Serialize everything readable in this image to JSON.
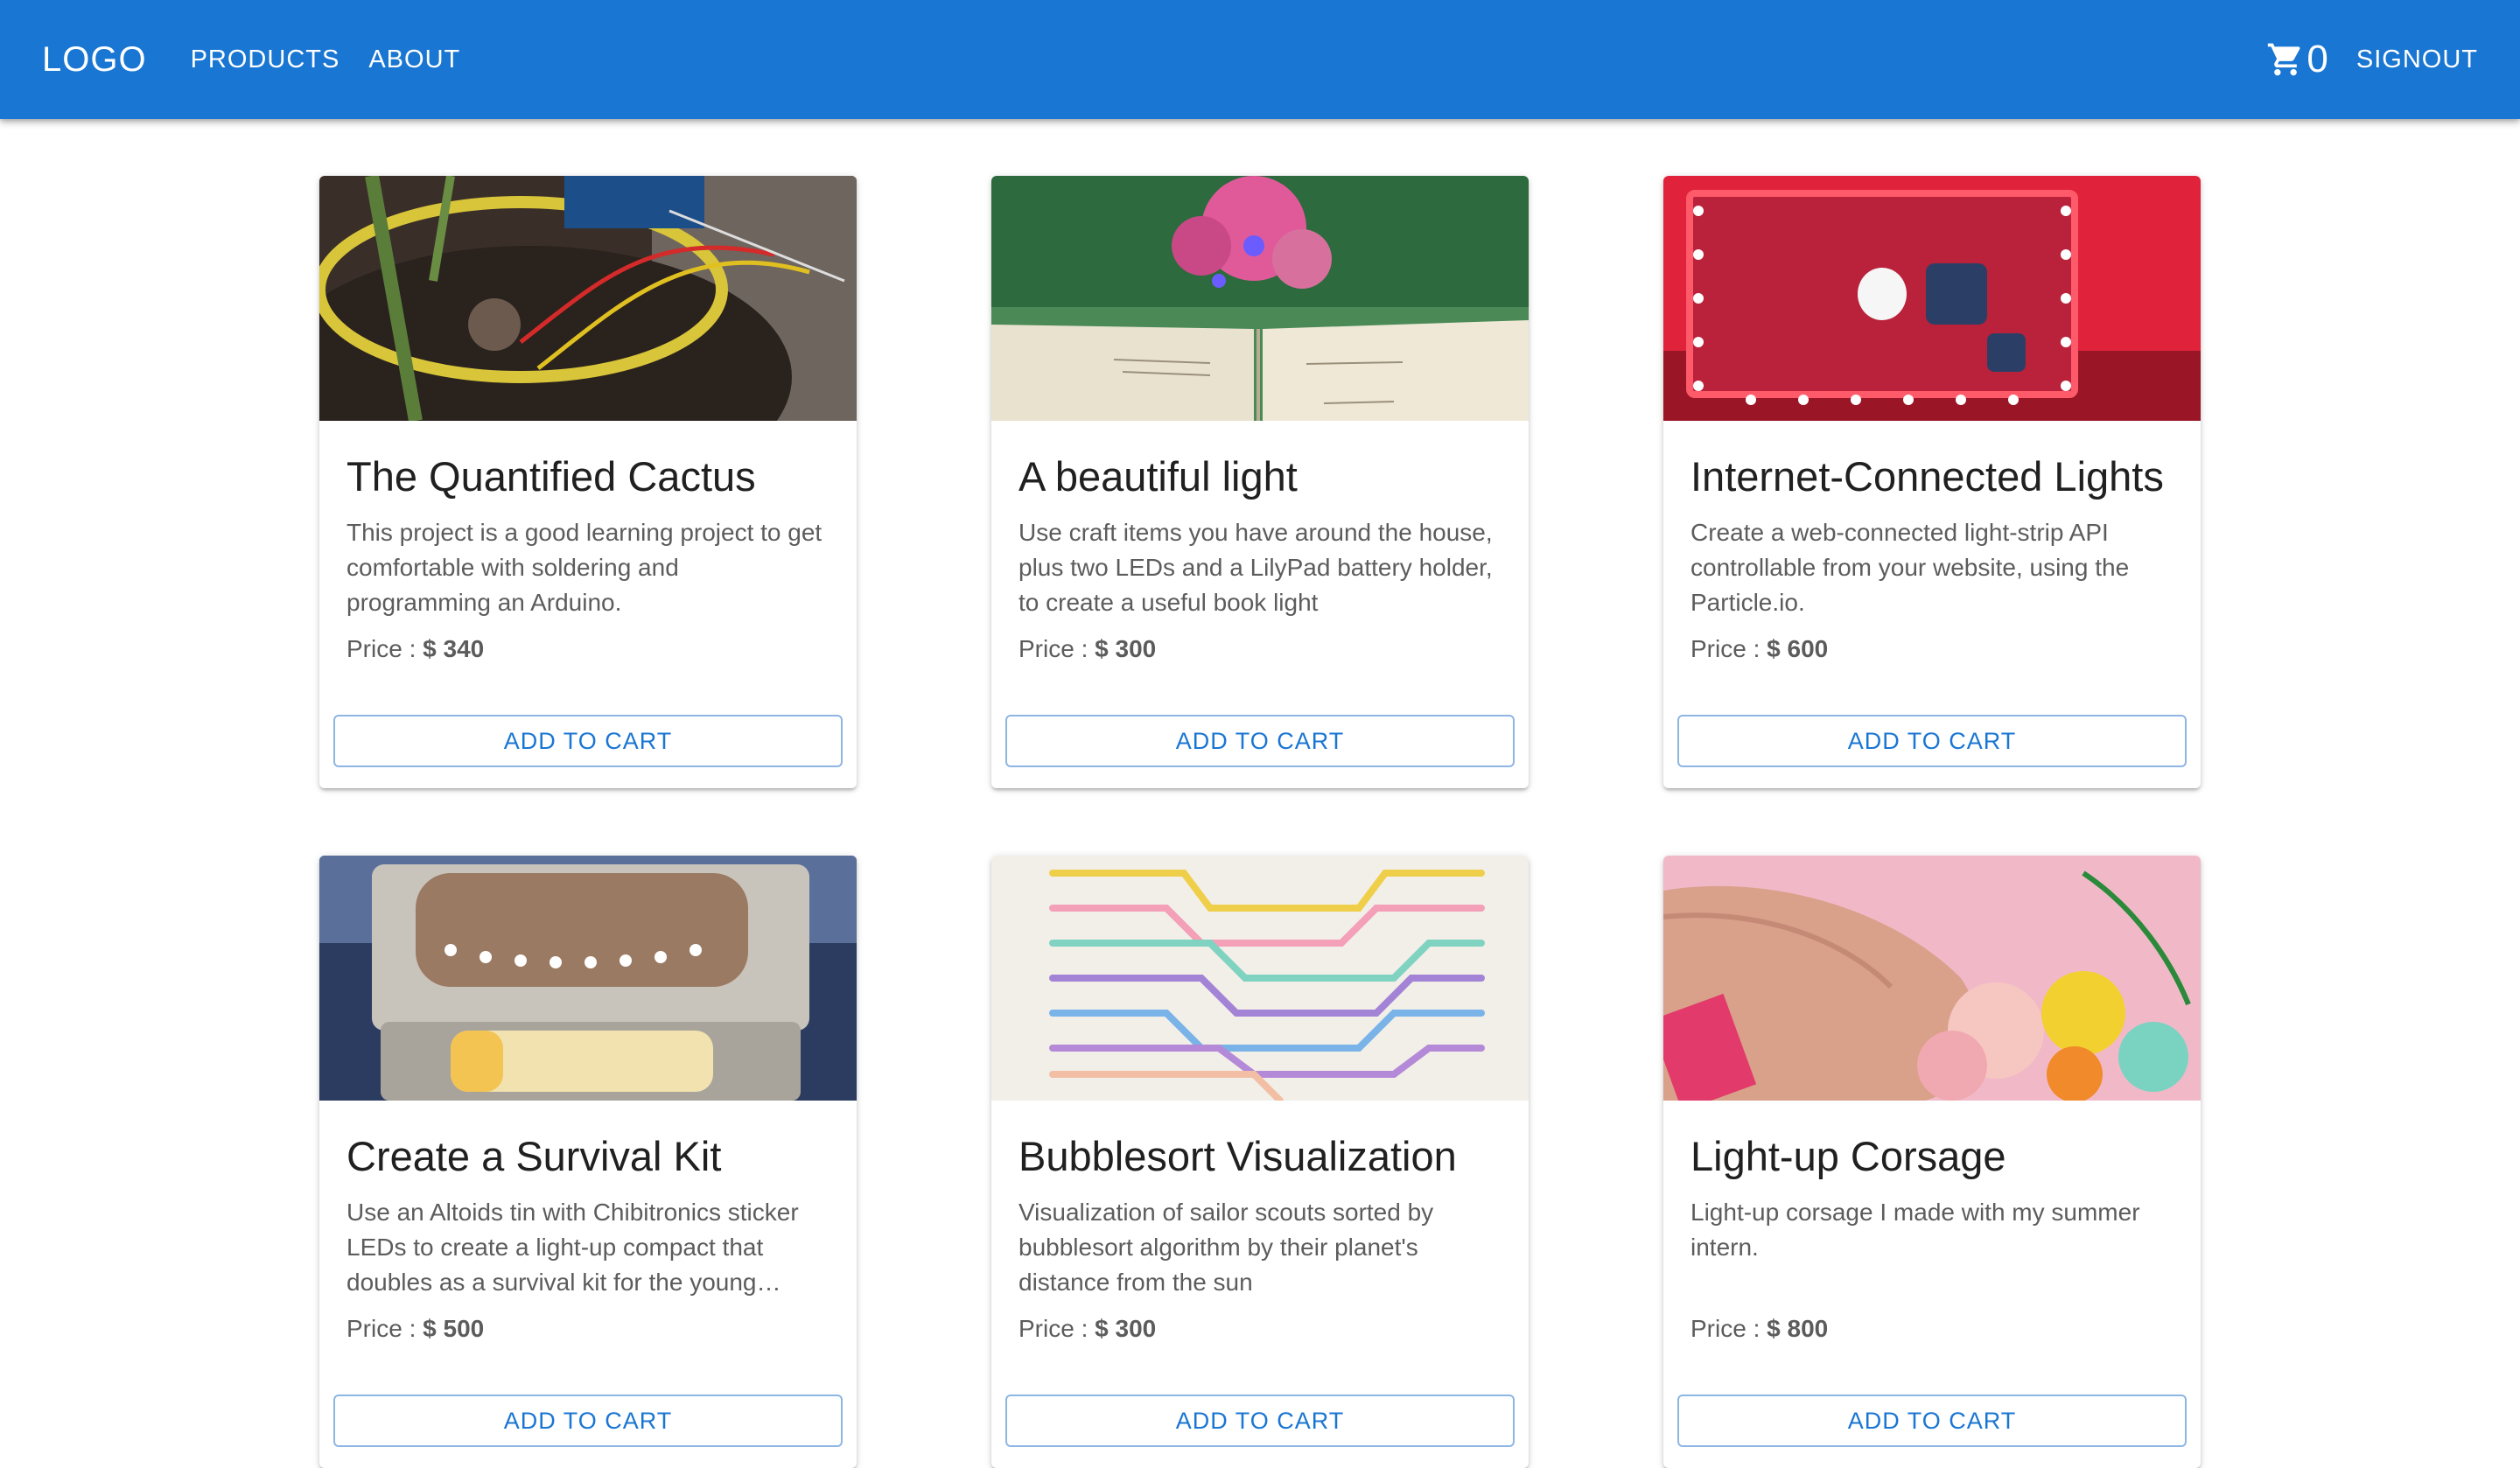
{
  "appbar": {
    "logo": "LOGO",
    "nav": [
      "PRODUCTS",
      "ABOUT"
    ],
    "cart_icon": "shopping-cart-icon",
    "cart_count": "0",
    "signout": "SIGNOUT",
    "color": "#1976d2"
  },
  "products": [
    {
      "title": "The Quantified Cactus",
      "description": "This project is a good learning project to get comfortable with soldering and programming an Arduino.",
      "price_label": "Price : ",
      "price": "$ 340",
      "button": "ADD TO CART"
    },
    {
      "title": "A beautiful light",
      "description": "Use craft items you have around the house, plus two LEDs and a LilyPad battery holder, to create a useful book light",
      "price_label": "Price : ",
      "price": "$ 300",
      "button": "ADD TO CART"
    },
    {
      "title": "Internet-Connected Lights",
      "description": "Create a web-connected light-strip API controllable from your website, using the Particle.io.",
      "price_label": "Price : ",
      "price": "$ 600",
      "button": "ADD TO CART"
    },
    {
      "title": "Create a Survival Kit",
      "description": "Use an Altoids tin with Chibitronics sticker LEDs to create a light-up compact that doubles as a survival kit for the young adventurer",
      "price_label": "Price : ",
      "price": "$ 500",
      "button": "ADD TO CART"
    },
    {
      "title": "Bubblesort Visualization",
      "description": "Visualization of sailor scouts sorted by bubblesort algorithm by their planet's distance from the sun",
      "price_label": "Price : ",
      "price": "$ 300",
      "button": "ADD TO CART"
    },
    {
      "title": "Light-up Corsage",
      "description": "Light-up corsage I made with my summer intern.",
      "price_label": "Price : ",
      "price": "$ 800",
      "button": "ADD TO CART"
    }
  ]
}
